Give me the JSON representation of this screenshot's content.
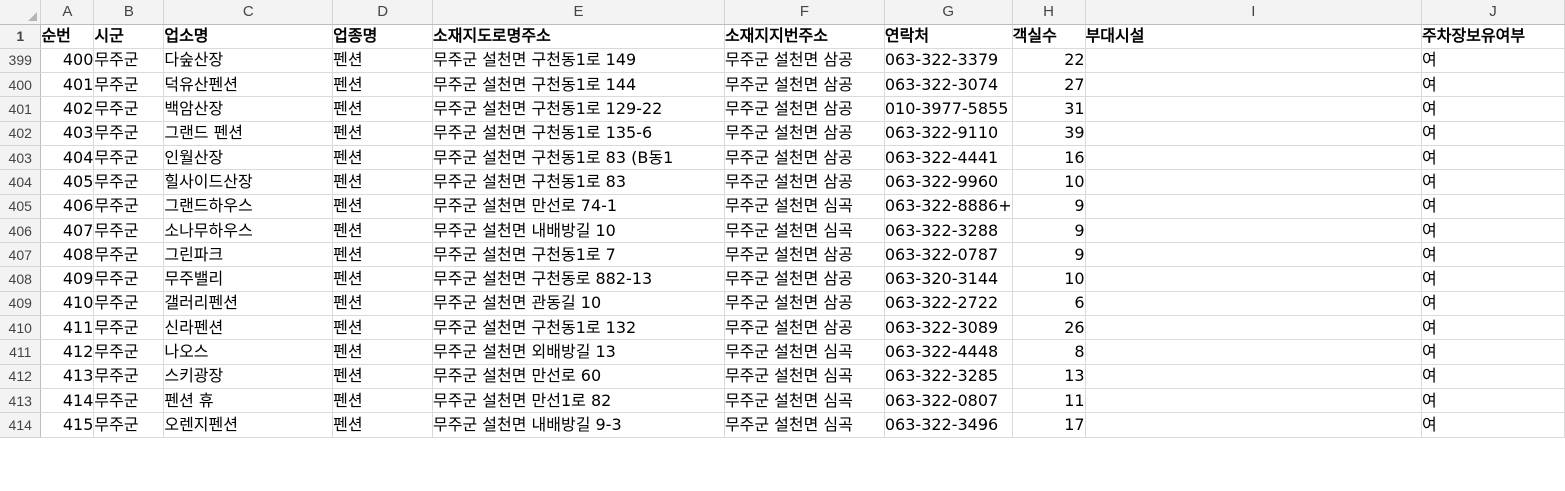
{
  "corner_label": "",
  "columns": [
    "A",
    "B",
    "C",
    "D",
    "E",
    "F",
    "G",
    "H",
    "I",
    "J"
  ],
  "header_row": {
    "row_number": "1",
    "cells": [
      "순번",
      "시군",
      "업소명",
      "업종명",
      "소재지도로명주소",
      "소재지지번주소",
      "연락처",
      "객실수",
      "부대시설",
      "주차장보유여부"
    ]
  },
  "rows": [
    {
      "row_number": "399",
      "cells": [
        "400",
        "무주군",
        "다숲산장",
        "펜션",
        "무주군 설천면 구천동1로 149",
        "무주군 설천면 삼공",
        "063-322-3379",
        "22",
        "",
        "여"
      ]
    },
    {
      "row_number": "400",
      "cells": [
        "401",
        "무주군",
        "덕유산펜션",
        "펜션",
        "무주군 설천면 구천동1로 144",
        "무주군 설천면 삼공",
        "063-322-3074",
        "27",
        "",
        "여"
      ]
    },
    {
      "row_number": "401",
      "cells": [
        "402",
        "무주군",
        "백암산장",
        "펜션",
        "무주군 설천면 구천동1로 129-22",
        "무주군 설천면 삼공",
        "010-3977-5855",
        "31",
        "",
        "여"
      ]
    },
    {
      "row_number": "402",
      "cells": [
        "403",
        "무주군",
        "그랜드 펜션",
        "펜션",
        "무주군 설천면 구천동1로 135-6",
        "무주군 설천면 삼공",
        "063-322-9110",
        "39",
        "",
        "여"
      ]
    },
    {
      "row_number": "403",
      "cells": [
        "404",
        "무주군",
        "인월산장",
        "펜션",
        "무주군 설천면 구천동1로 83 (B동1",
        "무주군 설천면 삼공",
        "063-322-4441",
        "16",
        "",
        "여"
      ]
    },
    {
      "row_number": "404",
      "cells": [
        "405",
        "무주군",
        "힐사이드산장",
        "펜션",
        "무주군 설천면 구천동1로 83",
        "무주군 설천면 삼공",
        "063-322-9960",
        "10",
        "",
        "여"
      ]
    },
    {
      "row_number": "405",
      "cells": [
        "406",
        "무주군",
        "그랜드하우스",
        "펜션",
        "무주군 설천면 만선로 74-1",
        "무주군 설천면 심곡",
        "063-322-8886+",
        "9",
        "",
        "여"
      ]
    },
    {
      "row_number": "406",
      "cells": [
        "407",
        "무주군",
        "소나무하우스",
        "펜션",
        "무주군 설천면 내배방길 10",
        "무주군 설천면 심곡",
        "063-322-3288",
        "9",
        "",
        "여"
      ]
    },
    {
      "row_number": "407",
      "cells": [
        "408",
        "무주군",
        "그린파크",
        "펜션",
        "무주군 설천면 구천동1로 7",
        "무주군 설천면 삼공",
        "063-322-0787",
        "9",
        "",
        "여"
      ]
    },
    {
      "row_number": "408",
      "cells": [
        "409",
        "무주군",
        "무주밸리",
        "펜션",
        "무주군 설천면 구천동로 882-13",
        "무주군 설천면 삼공",
        "063-320-3144",
        "10",
        "",
        "여"
      ]
    },
    {
      "row_number": "409",
      "cells": [
        "410",
        "무주군",
        "갤러리펜션",
        "펜션",
        "무주군 설천면 관동길 10",
        "무주군 설천면 삼공",
        "063-322-2722",
        "6",
        "",
        "여"
      ]
    },
    {
      "row_number": "410",
      "cells": [
        "411",
        "무주군",
        "신라펜션",
        "펜션",
        "무주군 설천면 구천동1로 132",
        "무주군 설천면 삼공",
        "063-322-3089",
        "26",
        "",
        "여"
      ]
    },
    {
      "row_number": "411",
      "cells": [
        "412",
        "무주군",
        "나오스",
        "펜션",
        "무주군 설천면 외배방길 13",
        "무주군 설천면 심곡",
        "063-322-4448",
        "8",
        "",
        "여"
      ]
    },
    {
      "row_number": "412",
      "cells": [
        "413",
        "무주군",
        "스키광장",
        "펜션",
        "무주군 설천면 만선로 60",
        "무주군 설천면 심곡",
        "063-322-3285",
        "13",
        "",
        "여"
      ]
    },
    {
      "row_number": "413",
      "cells": [
        "414",
        "무주군",
        "펜션 휴",
        "펜션",
        "무주군 설천면 만선1로 82",
        "무주군 설천면 심곡",
        "063-322-0807",
        "11",
        "",
        "여"
      ]
    },
    {
      "row_number": "414",
      "cells": [
        "415",
        "무주군",
        "오렌지펜션",
        "펜션",
        "무주군 설천면 내배방길 9-3",
        "무주군 설천면 심곡",
        "063-322-3496",
        "17",
        "",
        "여"
      ]
    }
  ],
  "colors": {
    "header_background": "#f3f3f3",
    "gridline": "#dadada",
    "header_text": "#444444"
  }
}
